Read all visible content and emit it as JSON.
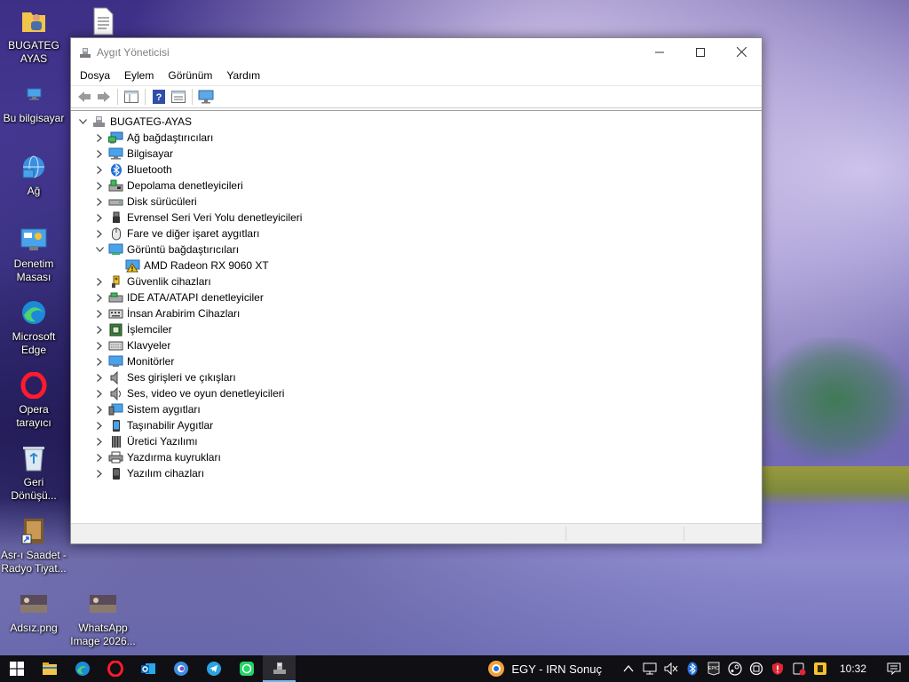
{
  "desktop": {
    "icons": [
      {
        "label": "BUGATEG AYAS",
        "icon": "folder-user-icon"
      },
      {
        "label": "",
        "icon": "text-file-icon"
      },
      {
        "label": "Bu bilgisayar",
        "icon": "computer-icon"
      },
      {
        "label": "Ağ",
        "icon": "network-icon"
      },
      {
        "label": "Denetim Masası",
        "icon": "control-panel-icon"
      },
      {
        "label": "Microsoft Edge",
        "icon": "edge-icon"
      },
      {
        "label": "Opera tarayıcı",
        "icon": "opera-icon"
      },
      {
        "label": "Geri Dönüşü...",
        "icon": "recycle-bin-icon"
      },
      {
        "label": "Asr-ı Saadet - Radyo Tiyat...",
        "icon": "shortcut-icon"
      },
      {
        "label": "Adsız.png",
        "icon": "image-file-icon"
      },
      {
        "label": "WhatsApp Image 2026...",
        "icon": "image-file-icon"
      }
    ]
  },
  "window": {
    "title": "Aygıt Yöneticisi",
    "menu": [
      "Dosya",
      "Eylem",
      "Görünüm",
      "Yardım"
    ],
    "tree": {
      "root": "BUGATEG-AYAS",
      "items": [
        {
          "label": "Ağ bağdaştırıcıları",
          "icon": "network-adapter-icon"
        },
        {
          "label": "Bilgisayar",
          "icon": "computer-icon"
        },
        {
          "label": "Bluetooth",
          "icon": "bluetooth-icon"
        },
        {
          "label": "Depolama denetleyicileri",
          "icon": "storage-controller-icon"
        },
        {
          "label": "Disk sürücüleri",
          "icon": "disk-drive-icon"
        },
        {
          "label": "Evrensel Seri Veri Yolu denetleyicileri",
          "icon": "usb-icon"
        },
        {
          "label": "Fare ve diğer işaret aygıtları",
          "icon": "mouse-icon"
        },
        {
          "label": "Görüntü bağdaştırıcıları",
          "icon": "display-adapter-icon",
          "expanded": true,
          "children": [
            {
              "label": "AMD Radeon RX 9060 XT",
              "icon": "display-adapter-warning-icon"
            }
          ]
        },
        {
          "label": "Güvenlik cihazları",
          "icon": "security-device-icon"
        },
        {
          "label": "IDE ATA/ATAPI denetleyiciler",
          "icon": "ide-controller-icon"
        },
        {
          "label": "İnsan Arabirim Cihazları",
          "icon": "hid-icon"
        },
        {
          "label": "İşlemciler",
          "icon": "processor-icon"
        },
        {
          "label": "Klavyeler",
          "icon": "keyboard-icon"
        },
        {
          "label": "Monitörler",
          "icon": "monitor-icon"
        },
        {
          "label": "Ses girişleri ve çıkışları",
          "icon": "speaker-icon"
        },
        {
          "label": "Ses, video ve oyun denetleyicileri",
          "icon": "sound-controller-icon"
        },
        {
          "label": "Sistem aygıtları",
          "icon": "system-device-icon"
        },
        {
          "label": "Taşınabilir Aygıtlar",
          "icon": "portable-device-icon"
        },
        {
          "label": "Üretici Yazılımı",
          "icon": "firmware-icon"
        },
        {
          "label": "Yazdırma kuyrukları",
          "icon": "printer-icon"
        },
        {
          "label": "Yazılım cihazları",
          "icon": "software-device-icon"
        }
      ]
    }
  },
  "taskbar": {
    "pinned": [
      "windows-start-icon",
      "file-explorer-icon",
      "edge-icon",
      "opera-icon",
      "outlook-icon",
      "copilot-icon",
      "telegram-icon",
      "whatsapp-icon",
      "device-manager-icon"
    ],
    "weather_text": "EGY - IRN Sonuç",
    "clock": "10:32"
  }
}
